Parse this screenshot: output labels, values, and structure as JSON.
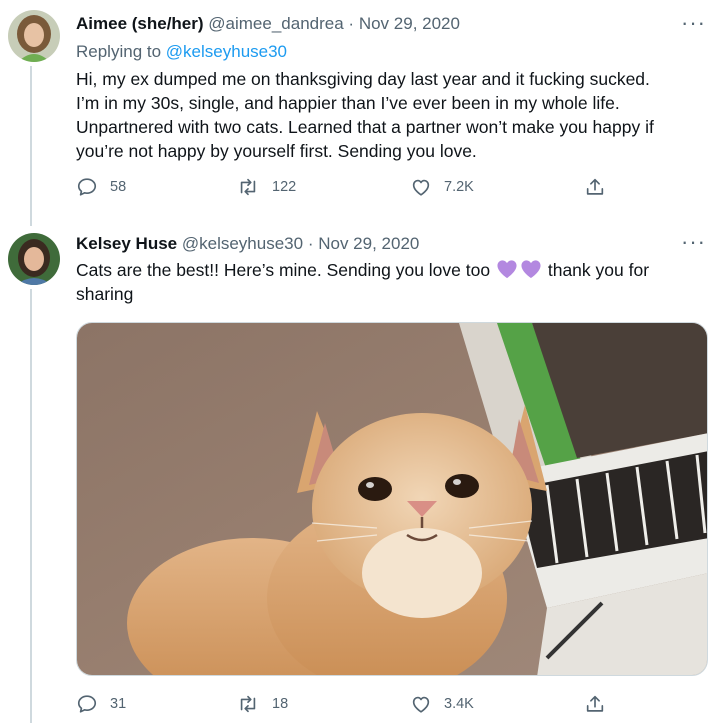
{
  "tweets": [
    {
      "display_name": "Aimee (she/her)",
      "handle": "@aimee_dandrea",
      "sep": "·",
      "date": "Nov 29, 2020",
      "replying_label": "Replying to",
      "replying_handle": "@kelseyhuse30",
      "lines": [
        "Hi, my ex dumped me on thanksgiving day last year and it fucking sucked.",
        "I’m in my 30s, single, and happier than I’ve ever been in my whole life.",
        "Unpartnered with two cats. Learned that a partner won’t make you happy if",
        "you’re not happy by yourself first. Sending you love."
      ],
      "replies": "58",
      "retweets": "122",
      "likes": "7.2K"
    },
    {
      "display_name": "Kelsey Huse",
      "handle": "@kelseyhuse30",
      "sep": "·",
      "date": "Nov 29, 2020",
      "line1_before": "Cats are the best!! Here’s mine. Sending you love too",
      "line1_after": "thank you for",
      "line2": "sharing",
      "replies": "31",
      "retweets": "18",
      "likes": "3.4K"
    }
  ],
  "more_glyph": "···",
  "colors": {
    "accent": "#1d9bf0",
    "secondary_text": "#536471",
    "emoji_heart": "#b388e0"
  },
  "icons": [
    "reply-icon",
    "retweet-icon",
    "like-icon",
    "share-icon",
    "more-icon",
    "purple-heart-icon"
  ]
}
